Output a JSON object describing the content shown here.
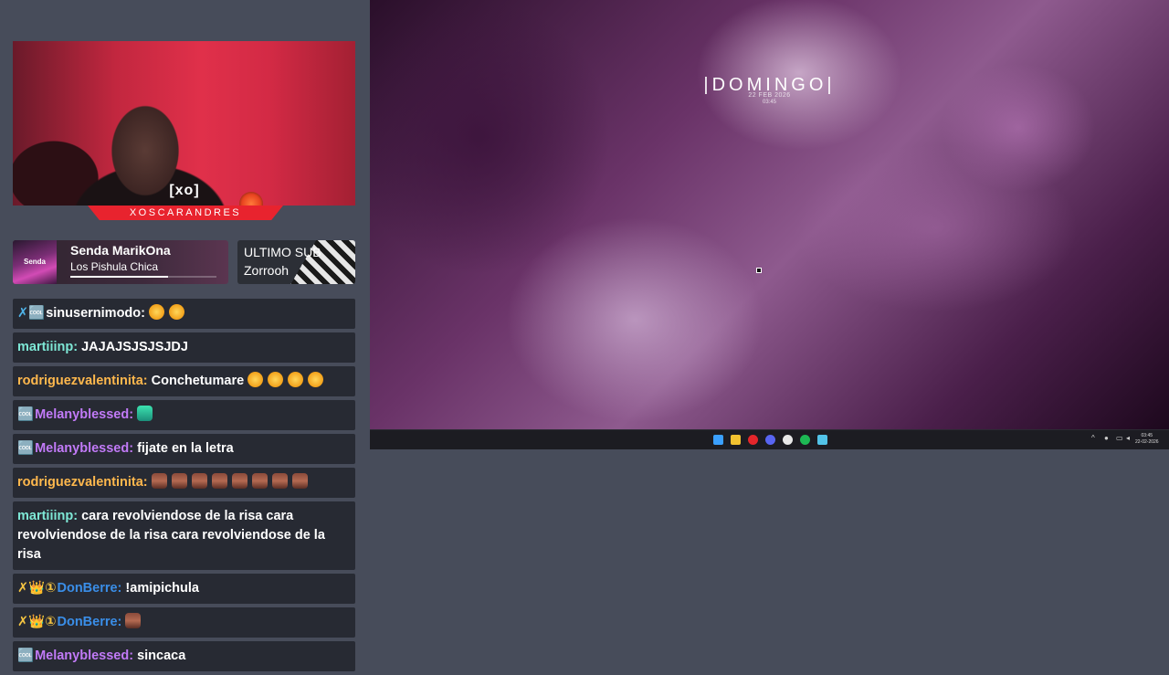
{
  "overlay": {
    "webcam": {
      "logo_text": "[xo]",
      "streamer_name": "XOSCARANDRES"
    },
    "now_playing": {
      "album_art_text": "Senda MarikOna",
      "title": "Senda MarikOna",
      "artist": "Los Pishula Chica",
      "progress": 0.67
    },
    "last_sub": {
      "label": "ULTIMO SUB",
      "name": "Zorrooh"
    }
  },
  "chat": {
    "messages": [
      {
        "badges": "✗🆒",
        "badge_color": "#4fb3e8",
        "user": "sinusernimodo:",
        "user_color": "#ffffff",
        "text": "",
        "emotes": [
          "laugh",
          "laugh"
        ]
      },
      {
        "badges": "",
        "badge_color": "",
        "user": "martiiinp:",
        "user_color": "#7ee8d6",
        "text": "JAJAJSJSJSJDJ",
        "emotes": []
      },
      {
        "badges": "",
        "badge_color": "",
        "user": "rodriguezvalentinita:",
        "user_color": "#ffb84d",
        "text": "Conchetumare",
        "emotes": [
          "laugh",
          "laugh",
          "laugh",
          "laugh"
        ]
      },
      {
        "badges": "🆒",
        "badge_color": "#3ce3b0",
        "user": "Melanyblessed:",
        "user_color": "#c17af7",
        "text": "",
        "emotes": [
          "chair"
        ]
      },
      {
        "badges": "🆒",
        "badge_color": "#3ce3b0",
        "user": "Melanyblessed:",
        "user_color": "#c17af7",
        "text": "fijate en la letra",
        "emotes": []
      },
      {
        "badges": "",
        "badge_color": "",
        "user": "rodriguezvalentinita:",
        "user_color": "#ffb84d",
        "text": "",
        "emotes": [
          "face",
          "face",
          "face",
          "face",
          "face",
          "face",
          "face",
          "face"
        ]
      },
      {
        "badges": "",
        "badge_color": "",
        "user": "martiiinp:",
        "user_color": "#7ee8d6",
        "text": "cara revolviendose de la risa cara revolviendose de la risa cara revolviendose de la risa",
        "emotes": []
      },
      {
        "badges": "✗👑①",
        "badge_color": "#f5c542",
        "user": "DonBerre:",
        "user_color": "#3a8ee8",
        "text": "!amipichula",
        "emotes": []
      },
      {
        "badges": "✗👑①",
        "badge_color": "#f5c542",
        "user": "DonBerre:",
        "user_color": "#3a8ee8",
        "text": "",
        "emotes": [
          "face"
        ]
      },
      {
        "badges": "🆒",
        "badge_color": "#3ce3b0",
        "user": "Melanyblessed:",
        "user_color": "#c17af7",
        "text": "sincaca",
        "emotes": []
      }
    ]
  },
  "desktop": {
    "clock": {
      "day": "|DOMINGO|",
      "date": "22 FEB 2026",
      "time": "03:45"
    },
    "taskbar": {
      "icons": [
        "windows-start-icon",
        "file-explorer-icon",
        "opera-icon",
        "discord-icon",
        "chrome-icon",
        "spotify-icon",
        "notepad-icon"
      ],
      "icon_colors": [
        "#3aa0ff",
        "#f2c230",
        "#e5262b",
        "#5865f2",
        "#e8e8e8",
        "#1db954",
        "#52c3e8"
      ],
      "tray_time": "03:45",
      "tray_date": "22-02-2026"
    }
  }
}
